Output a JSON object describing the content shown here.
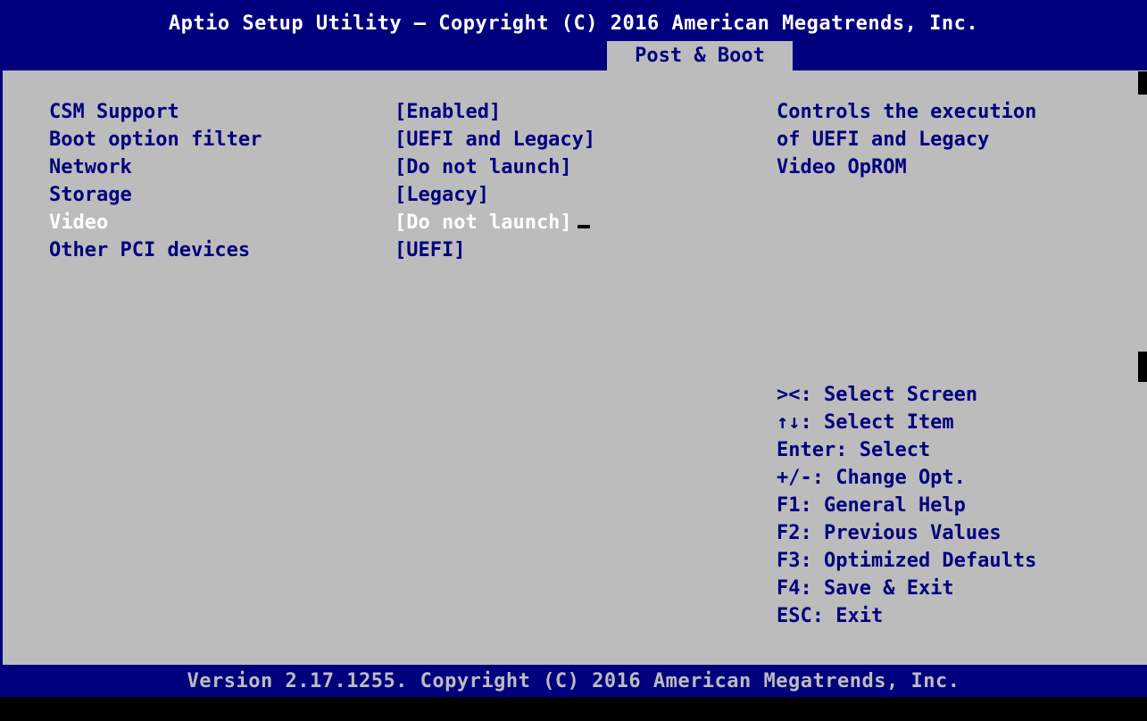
{
  "header": {
    "title": "Aptio Setup Utility – Copyright (C) 2016 American Megatrends, Inc.",
    "active_tab": "Post & Boot"
  },
  "settings": [
    {
      "label": "CSM Support",
      "value": "[Enabled]"
    },
    {
      "label": "Boot option filter",
      "value": "[UEFI and Legacy]"
    },
    {
      "label": "Network",
      "value": "[Do not launch]"
    },
    {
      "label": "Storage",
      "value": "[Legacy]"
    },
    {
      "label": "Video",
      "value": "[Do not launch]"
    },
    {
      "label": "Other PCI devices",
      "value": "[UEFI]"
    }
  ],
  "selected_setting": "Video",
  "help": {
    "lines": [
      "Controls the execution",
      "of UEFI and Legacy",
      "Video OpROM"
    ]
  },
  "keys": [
    "><: Select Screen",
    "↑↓: Select Item",
    "Enter: Select",
    "+/-: Change Opt.",
    "F1: General Help",
    "F2: Previous Values",
    "F3: Optimized Defaults",
    "F4: Save & Exit",
    "ESC: Exit"
  ],
  "footer": {
    "text": "Version 2.17.1255. Copyright (C) 2016 American Megatrends, Inc."
  },
  "colors": {
    "bios_blue": "#00007f",
    "bios_gray": "#bcbcbc",
    "highlight_white": "#ffffff"
  }
}
